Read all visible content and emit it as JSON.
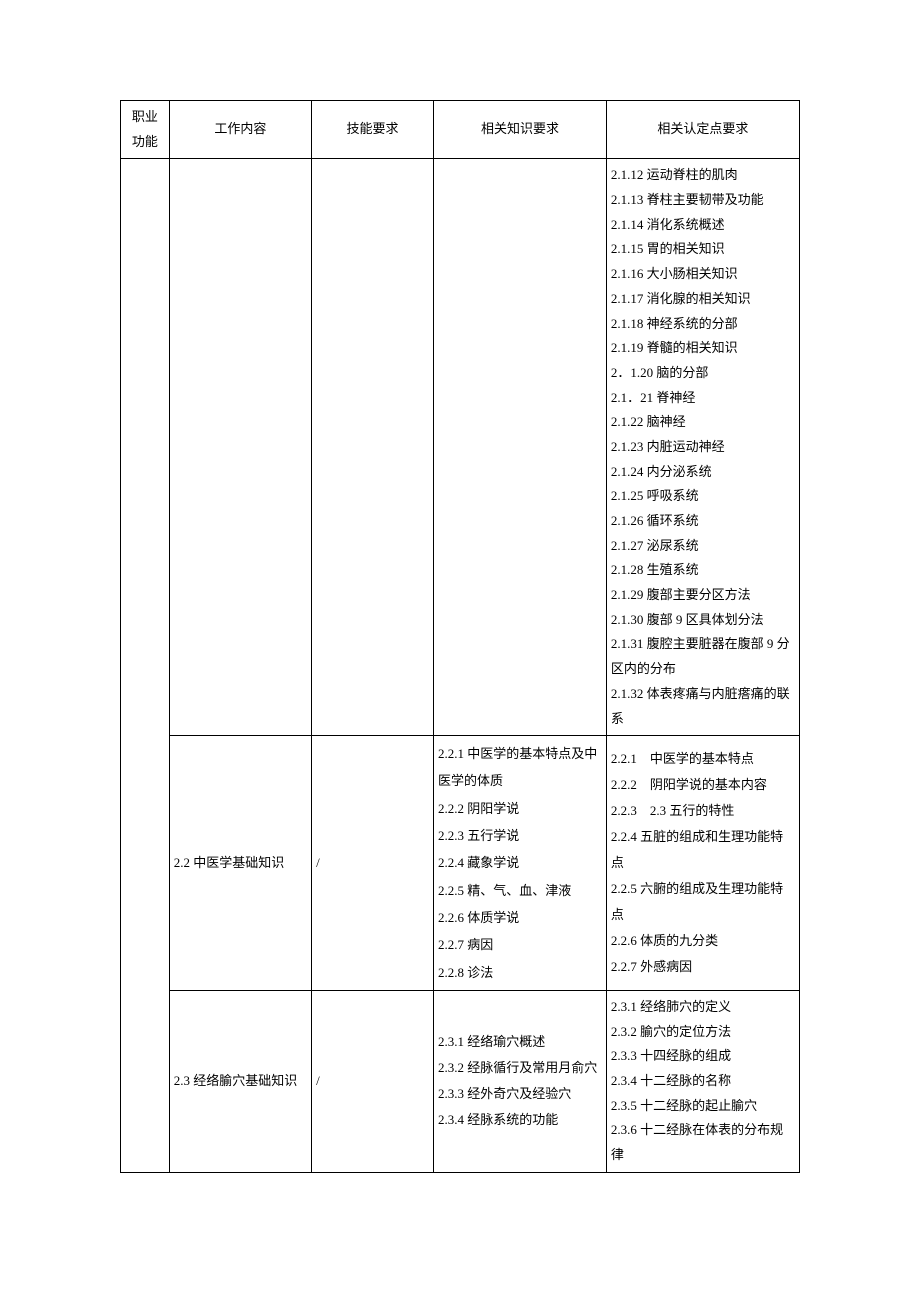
{
  "headers": {
    "col1a": "职业",
    "col1b": "功能",
    "col2": "工作内容",
    "col3": "技能要求",
    "col4": "相关知识要求",
    "col5": "相关认定点要求"
  },
  "rows": [
    {
      "work": "",
      "skill": "",
      "knowledge": "",
      "points": "2.1.12 运动脊柱的肌肉\n2.1.13 脊柱主要韧带及功能\n2.1.14 消化系统概述\n2.1.15 胃的相关知识\n2.1.16 大小肠相关知识\n2.1.17 消化腺的相关知识\n2.1.18 神经系统的分部\n2.1.19 脊髓的相关知识\n2．1.20 脑的分部\n2.1．21 脊神经\n2.1.22 脑神经\n2.1.23 内脏运动神经\n2.1.24 内分泌系统\n2.1.25 呼吸系统\n2.1.26 循环系统\n2.1.27 泌尿系统\n2.1.28 生殖系统\n2.1.29 腹部主要分区方法\n2.1.30 腹部 9 区具体划分法\n2.1.31 腹腔主要脏器在腹部 9 分区内的分布\n2.1.32 体表疼痛与内脏瘩痛的联系\n "
    },
    {
      "work": "2.2 中医学基础知识",
      "skill": "/",
      "knowledge": "2.2.1 中医学的基本特点及中医学的体质\n2.2.2 阴阳学说\n2.2.3 五行学说\n2.2.4 藏象学说\n2.2.5 精、气、血、津液\n2.2.6 体质学说\n2.2.7 病因\n2.2.8 诊法",
      "points": "2.2.1　中医学的基本特点\n2.2.2　阴阳学说的基本内容\n2.2.3　2.3 五行的特性\n2.2.4 五脏的组成和生理功能特点\n2.2.5 六腑的组成及生理功能特点\n2.2.6 体质的九分类\n2.2.7 外感病因"
    },
    {
      "work": "2.3 经络腧穴基础知识",
      "skill": "/",
      "knowledge": "2.3.1 经络瑜穴概述\n2.3.2 经脉循行及常用月俞穴\n2.3.3 经外奇穴及经验穴\n2.3.4 经脉系统的功能",
      "points": "2.3.1 经络肺穴的定义\n2.3.2 腧穴的定位方法\n2.3.3 十四经脉的组成\n2.3.4 十二经脉的名称\n2.3.5 十二经脉的起止腧穴\n2.3.6 十二经脉在体表的分布规律"
    }
  ]
}
